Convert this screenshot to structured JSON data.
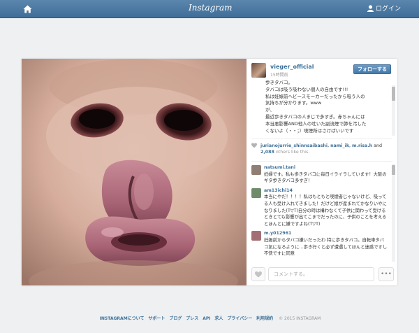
{
  "topbar": {
    "brand": "Instagram",
    "login_label": "ログイン",
    "home_icon": "home-icon",
    "user_icon": "user-icon"
  },
  "post": {
    "username": "vieger_official",
    "time_ago": "15時間前",
    "follow_label": "フォローする",
    "caption": [
      "歩きタバコ。",
      "タバコは吸う吸わない個人の自由です!!!",
      "私は妊娠前ヘビースモーカーだったから吸う人の",
      "気持ちが分かります。www",
      "が、",
      "最近歩きタバコの人まじで多すぎ。赤ちゃんには",
      "本当悪影響AND他人の吐いた副流煙で肺を汚した",
      "くないよ（・・；）喫煙所はさけばいいです"
    ],
    "likes": {
      "users": [
        "jurianojurrie_shinnsaibashi",
        "nami_ik",
        "m.risa.h"
      ],
      "and_word": "and",
      "count": "2,088",
      "others_text": "others like this."
    },
    "comments": [
      {
        "user": "natsumi.tani",
        "text": "妊婦です。私も歩きタバコに毎日イライラしています！大阪のギタ歩きタバコ多すぎ！"
      },
      {
        "user": "am13ichi14",
        "text": "本当にやだ！！！！私はもともと喫煙者じゃないけど、吸ってる人も受け入れてきました！だけど娘が産まれてかなりいやになりました(T▽T)自分の時は構わなくて子供に関わって受けるときとても影響が出てこまでだったのに、子供のことを考えるとほんとに嫌ですよね(T▽T)"
      },
      {
        "user": "m.y012961",
        "text": "妊娠前からタバコ嫌いだったわ 特に歩きタバコ。自転車タバコ気になるように…歩き行くと必ず遭遇してほんと迷惑ですし不快ですに同意"
      }
    ],
    "comment_placeholder": "コメントする。",
    "more_label": "•••"
  },
  "footer": {
    "links": [
      "INSTAGRAMについて",
      "サポート",
      "ブログ",
      "プレス",
      "API",
      "求人",
      "プライバシー",
      "利用規約"
    ],
    "copyright": "© 2015 INSTAGRAM"
  },
  "colors": {
    "topbar": "#4f7ca6",
    "link": "#3f729b",
    "background": "#eef0f2"
  }
}
